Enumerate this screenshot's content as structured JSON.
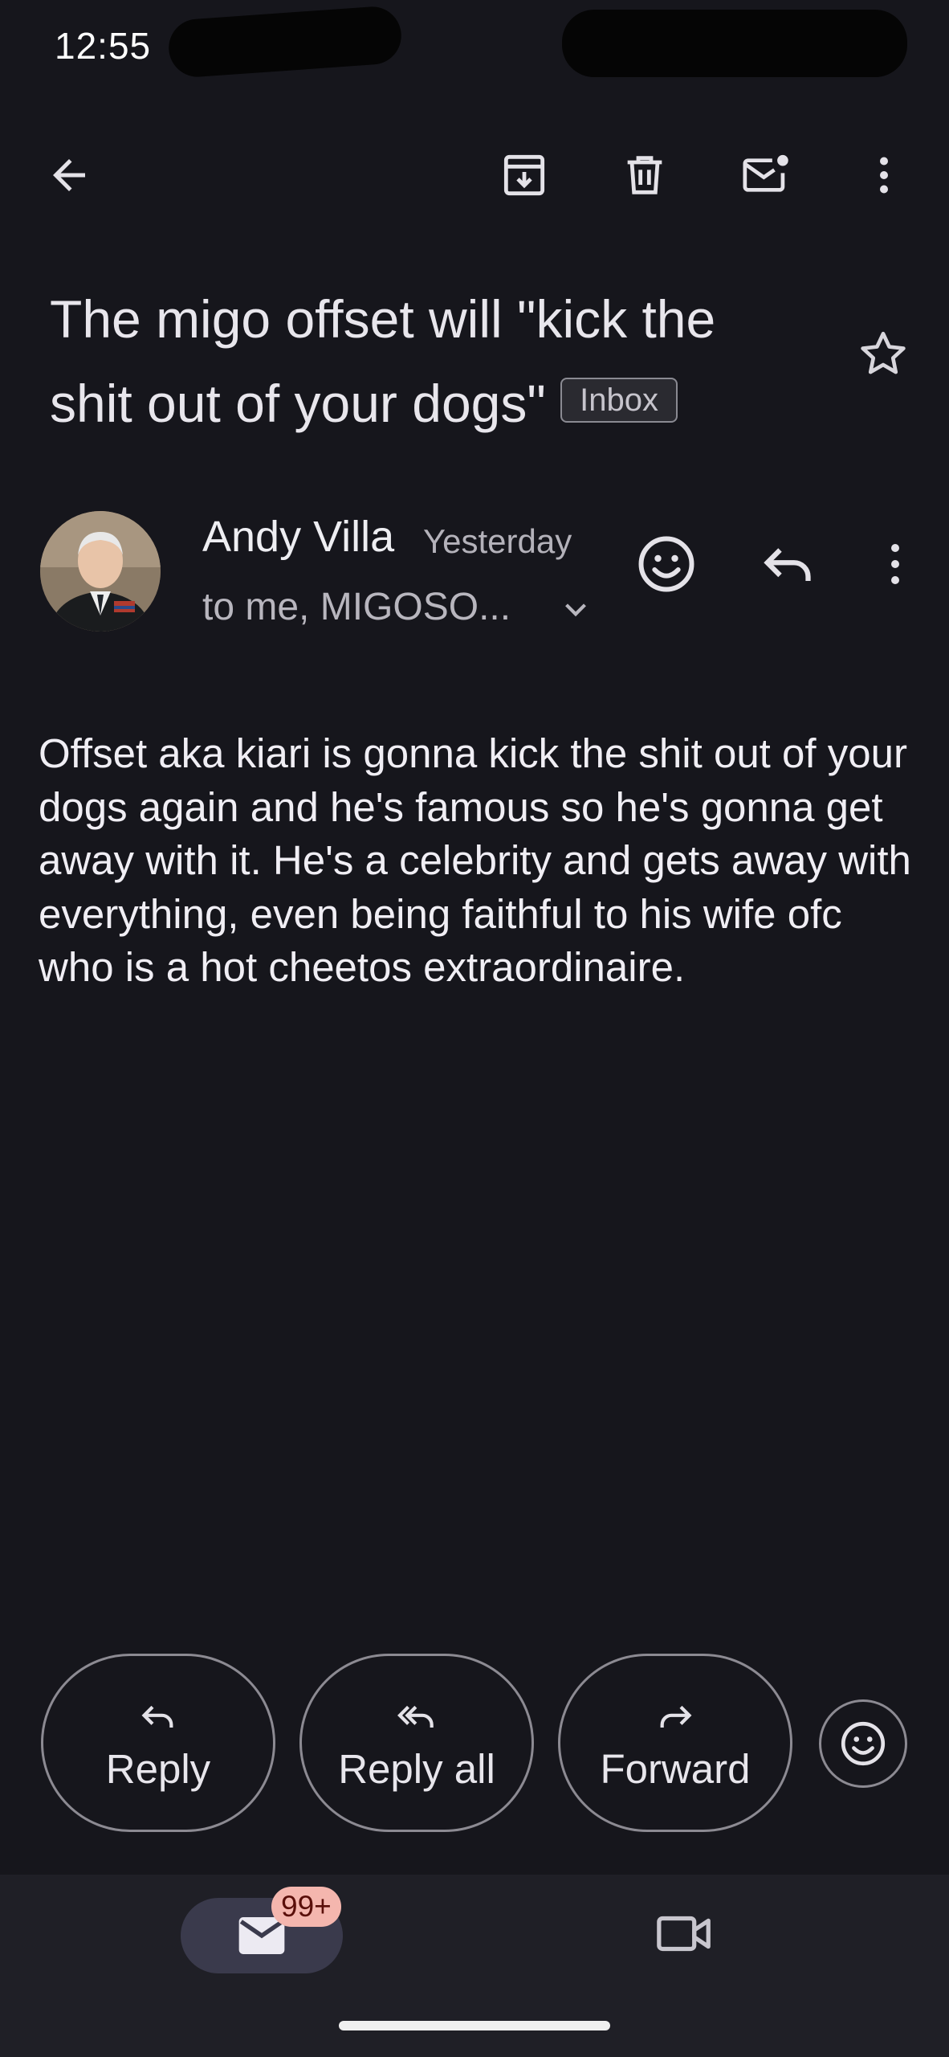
{
  "status_bar": {
    "time": "12:55"
  },
  "toolbar": {
    "back_icon": "arrow-back-icon",
    "archive_icon": "archive-icon",
    "delete_icon": "trash-icon",
    "mark_unread_icon": "mail-unread-icon",
    "more_icon": "more-vert-icon"
  },
  "email": {
    "subject_line1": "The migo offset will \"kick the",
    "subject_line2": "shit out of your dogs\"",
    "label": "Inbox",
    "sender": "Andy Villa",
    "time": "Yesterday",
    "recipients": "to me, MIGOSO...",
    "body": "Offset aka kiari is gonna kick the shit out of your dogs again and he's famous so he's gonna get away with it. He's a celebrity and gets away with everything, even being faithful to his wife ofc who is a hot cheetos extraordinaire."
  },
  "actions": {
    "reply": "Reply",
    "reply_all": "Reply all",
    "forward": "Forward"
  },
  "bottom_nav": {
    "mail_badge": "99+",
    "mail_icon": "mail-icon",
    "meet_icon": "video-camera-icon"
  },
  "colors": {
    "background": "#16161c",
    "nav_background": "#1f1f26",
    "badge_bg": "#f4b6ae",
    "badge_text": "#5a0f0a"
  }
}
